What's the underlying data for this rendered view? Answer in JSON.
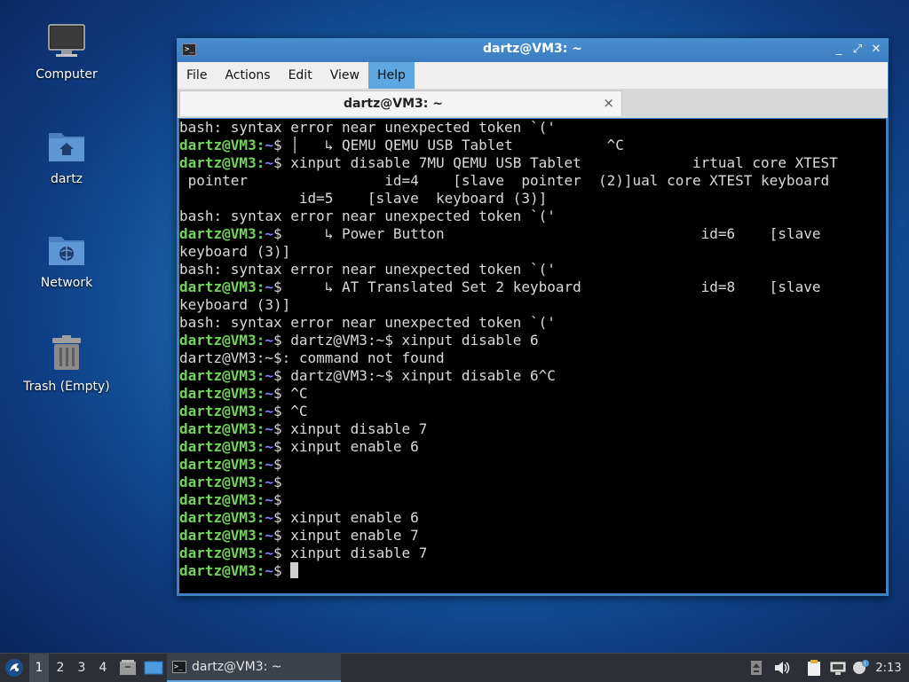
{
  "desktop": {
    "icons": [
      {
        "label": "Computer"
      },
      {
        "label": "dartz"
      },
      {
        "label": "Network"
      },
      {
        "label": "Trash (Empty)"
      }
    ]
  },
  "window": {
    "title": "dartz@VM3: ~",
    "title_icon": ">_",
    "controls": {
      "minimize": "_",
      "maximize": "⤢",
      "close": "✕"
    },
    "menu": [
      "File",
      "Actions",
      "Edit",
      "View",
      "Help"
    ],
    "active_menu": "Help",
    "tab": {
      "label": "dartz@VM3: ~",
      "close": "×"
    }
  },
  "terminal": {
    "prompt_user": "dartz@VM3:",
    "prompt_path": "~",
    "prompt_symbol": "$",
    "lines": [
      {
        "text": "bash: syntax error near unexpected token `('"
      },
      {
        "prompt": true,
        "text": " │   ↳ QEMU QEMU USB Tablet           ^C"
      },
      {
        "prompt": true,
        "text": " xinput disable 7MU QEMU USB Tablet             irtual core XTEST"
      },
      {
        "text": " pointer                id=4    [slave  pointer  (2)]ual core XTEST keyboard"
      },
      {
        "text": "              id=5    [slave  keyboard (3)]"
      },
      {
        "text": "bash: syntax error near unexpected token `('"
      },
      {
        "prompt": true,
        "text": "     ↳ Power Button                              id=6    [slave"
      },
      {
        "text": "keyboard (3)]"
      },
      {
        "text": "bash: syntax error near unexpected token `('"
      },
      {
        "prompt": true,
        "text": "     ↳ AT Translated Set 2 keyboard              id=8    [slave"
      },
      {
        "text": "keyboard (3)]"
      },
      {
        "text": "bash: syntax error near unexpected token `('"
      },
      {
        "prompt": true,
        "text": " dartz@VM3:~$ xinput disable 6"
      },
      {
        "text": "dartz@VM3:~$: command not found"
      },
      {
        "prompt": true,
        "text": " dartz@VM3:~$ xinput disable 6^C"
      },
      {
        "prompt": true,
        "text": " ^C"
      },
      {
        "prompt": true,
        "text": " ^C"
      },
      {
        "prompt": true,
        "text": " xinput disable 7"
      },
      {
        "prompt": true,
        "text": " xinput enable 6"
      },
      {
        "prompt": true,
        "text": ""
      },
      {
        "prompt": true,
        "text": ""
      },
      {
        "prompt": true,
        "text": ""
      },
      {
        "prompt": true,
        "text": " xinput enable 6"
      },
      {
        "prompt": true,
        "text": " xinput enable 7"
      },
      {
        "prompt": true,
        "text": " xinput disable 7"
      },
      {
        "prompt": true,
        "text": " ",
        "cursor": true
      }
    ]
  },
  "taskbar": {
    "workspaces": [
      "1",
      "2",
      "3",
      "4"
    ],
    "active_workspace": "1",
    "task_label": "dartz@VM3: ~",
    "clock": "2:13"
  },
  "colors": {
    "prompt_user": "#74d35a",
    "prompt_path": "#7b86f5",
    "accent": "#5ea6df"
  }
}
